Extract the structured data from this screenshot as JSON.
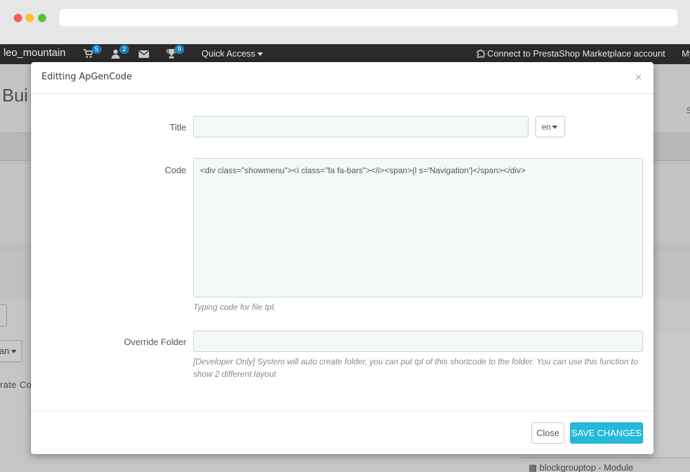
{
  "topbar": {
    "shop_name": "leo_mountain",
    "orders_badge": "5",
    "customers_badge": "2",
    "trophy_badge": "9",
    "quick_access": "Quick Access",
    "connect": "Connect to PrestaShop Marketplace account",
    "my": "My"
  },
  "background": {
    "page_title": "Bui",
    "side_letter": "S",
    "dropdown_fragment": "an",
    "text_fragment": "rate Co",
    "module_row": "blockgrouptop - Module"
  },
  "modal": {
    "title": "Editting ApGenCode",
    "close_symbol": "×",
    "fields": {
      "title_label": "Title",
      "title_value": "",
      "language": "en",
      "code_label": "Code",
      "code_value": "<div class=\"showmenu\"><i class=\"fa fa-bars\"></i><span>{l s='Navigation'}</span></div>",
      "code_help": "Typing code for file tpl.",
      "override_label": "Override Folder",
      "override_value": "",
      "override_help": "[Developer Only] System will auto create folder, you can put tpl of this shortcode to the folder. You can use this function to show 2 different layout"
    },
    "footer": {
      "close_label": "Close",
      "save_label": "SAVE CHANGES"
    }
  },
  "colors": {
    "topbar_bg": "#2a2a2a",
    "badge": "#1b7fc2",
    "primary_button": "#25b9d7",
    "input_bg": "#f5f8f9"
  },
  "icons": [
    "cart-icon",
    "user-icon",
    "envelope-icon",
    "trophy-icon",
    "puzzle-icon",
    "module-icon"
  ]
}
